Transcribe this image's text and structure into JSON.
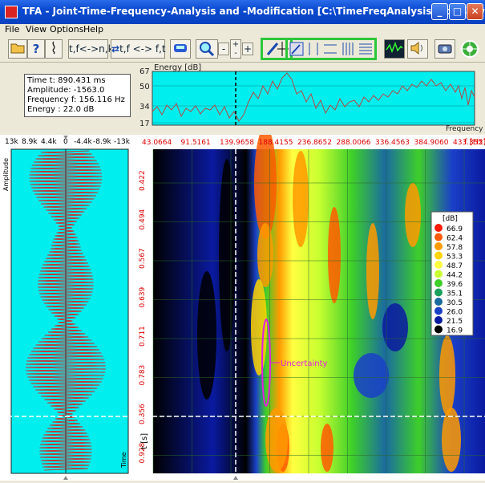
{
  "window": {
    "title": "TFA - Joint-Time-Frequency-Analysis and -Modification [C:\\TimeFreqAnalysis\\ind_tfa.wav]",
    "min_glyph": "_",
    "max_glyph": "□",
    "close_glyph": "✕"
  },
  "menu": {
    "items": [
      "File",
      "View",
      "Options",
      "Help"
    ]
  },
  "toolbar": {
    "open_icon": "folder-open-icon",
    "help_glyph": "?",
    "swap_label": "t,f<->n,k",
    "tf_label": "t,f <-> f,t",
    "buttons": [
      "open",
      "help",
      "info",
      "tf-nk",
      "tf-ft",
      "color",
      "zoom",
      "minus",
      "plusminus",
      "plus",
      "select",
      "grid",
      "exit"
    ]
  },
  "info": {
    "time": "Time t: 890.431 ms",
    "amplitude": "Amplitude: -1563.0",
    "frequency": "Frequency f: 156.116 Hz",
    "energy": "Energy : 22.0 dB"
  },
  "energy_plot": {
    "title": "Energy [dB]",
    "yticks": [
      "67",
      "50",
      "34",
      "17"
    ],
    "xlabel": "Frequency",
    "bg": "#00eeee",
    "line": "#b44848"
  },
  "waveform": {
    "xticks": [
      "13k",
      "8.9k",
      "4.4k",
      "0",
      "-4.4k",
      "-8.9k",
      "-13k"
    ],
    "ylabel": "Amplitude",
    "tlabel": "Time",
    "bg": "#00eeee",
    "line": "#ff0000"
  },
  "spectrogram": {
    "freq_ticks": [
      "43.0664",
      "91.5161",
      "139.9658",
      "188.4155",
      "236.8652",
      "288.0066",
      "336.4563",
      "384.9060",
      "433.3557"
    ],
    "freq_unit": "f [Hz]",
    "time_ticks": [
      "0.422",
      "0.494",
      "0.567",
      "0.639",
      "0.711",
      "0.783",
      "0.856",
      "0.928"
    ],
    "time_unit": "t [s]",
    "uncertainty_label": "Uncertainty",
    "tick_color": "#dd0000"
  },
  "legend": {
    "unit": "[dB]",
    "levels": [
      "66.9",
      "62.4",
      "57.8",
      "53.3",
      "48.7",
      "44.2",
      "39.6",
      "35.1",
      "30.5",
      "26.0",
      "21.5",
      "16.9"
    ],
    "colors": [
      "#ff1a00",
      "#ff5a00",
      "#ff9a00",
      "#ffd400",
      "#ffff40",
      "#c8ff30",
      "#3ecf2a",
      "#1aa05a",
      "#1a6aa0",
      "#1a40c8",
      "#0a1aa0",
      "#000000"
    ]
  }
}
